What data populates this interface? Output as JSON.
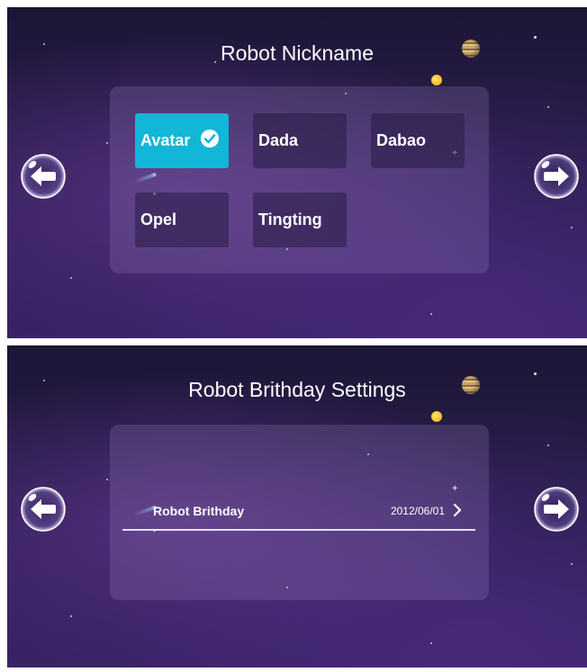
{
  "screens": [
    {
      "title": "Robot Nickname",
      "names": [
        {
          "label": "Avatar",
          "selected": true
        },
        {
          "label": "Dada",
          "selected": false
        },
        {
          "label": "Dabao",
          "selected": false
        },
        {
          "label": "Opel",
          "selected": false
        },
        {
          "label": "Tingting",
          "selected": false
        }
      ]
    },
    {
      "title": "Robot Brithday Settings",
      "row": {
        "label": "Robot Brithday",
        "value": "2012/06/01"
      }
    }
  ],
  "icons": {
    "back": "left-arrow-bubble-icon",
    "forward": "right-arrow-bubble-icon",
    "check": "check-circle-icon",
    "chevron": "chevron-right-icon"
  },
  "colors": {
    "selected_tile": "#12b6d6",
    "tile": "#281c46",
    "background": "#2a1d4c",
    "text": "#ffffff"
  }
}
